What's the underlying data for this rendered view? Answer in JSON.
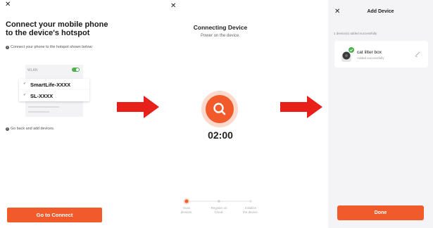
{
  "colors": {
    "accent": "#f15a2a",
    "arrow": "#e8201c",
    "success": "#4caf50",
    "background_panel": "#f4f4f6"
  },
  "screen1": {
    "close_icon": "close-icon",
    "title_line1": "Connect your mobile phone",
    "title_line2": "to the device's hotspot",
    "step1_num": "1",
    "step1_text": "Connect your phone to the hotspot shown below:",
    "wlan_label": "WLAN",
    "networks": [
      {
        "check": "✓",
        "name": "SmartLife-XXXX"
      },
      {
        "check": "✓",
        "name": "SL-XXXX"
      }
    ],
    "step2_num": "2",
    "step2_text": "Go back and add devices.",
    "button_label": "Go to Connect"
  },
  "screen2": {
    "close_icon": "close-icon",
    "title": "Connecting Device",
    "subtitle": "Power on the device.",
    "timer": "02:00",
    "steps": [
      {
        "line1": "Scan",
        "line2": "devices."
      },
      {
        "line1": "Register on",
        "line2": "Cloud."
      },
      {
        "line1": "Initialize",
        "line2": "the device."
      }
    ]
  },
  "screen3": {
    "close_icon": "close-icon",
    "title": "Add Device",
    "info": "1 device(s) added successfully",
    "device_name": "cat litter box",
    "device_status": "Added successfully",
    "button_label": "Done"
  }
}
